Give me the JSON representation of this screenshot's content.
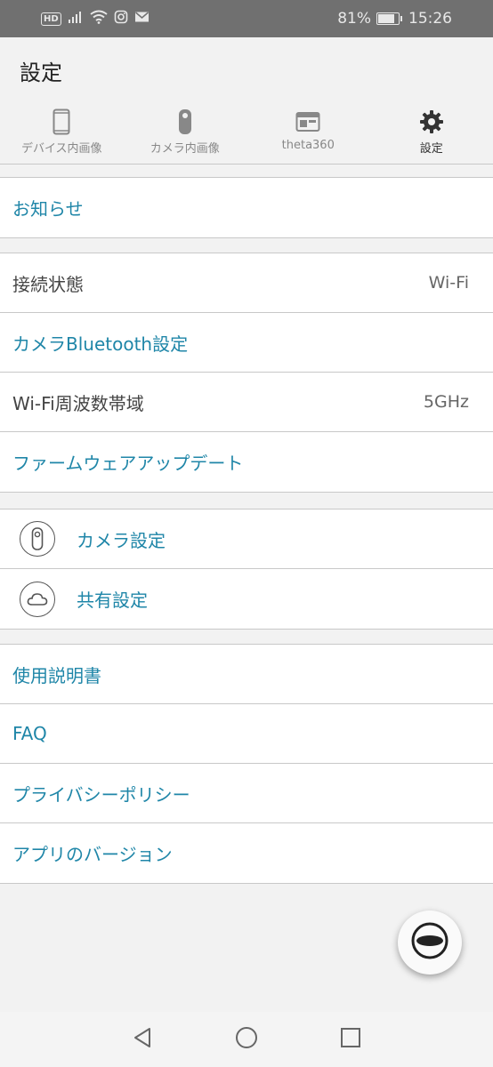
{
  "status_bar": {
    "hd_badge": "HD",
    "battery_percent": "81%",
    "battery_level": 0.81,
    "time": "15:26",
    "icons": [
      "hd-icon",
      "signal-icon",
      "wifi-icon",
      "instagram-icon",
      "mail-icon",
      "battery-icon"
    ]
  },
  "header": {
    "title": "設定"
  },
  "tabs": [
    {
      "label": "デバイス内画像",
      "icon": "phone-icon",
      "active": false
    },
    {
      "label": "カメラ内画像",
      "icon": "camera-icon",
      "active": false
    },
    {
      "label": "theta360",
      "icon": "browser-icon",
      "active": false
    },
    {
      "label": "設定",
      "icon": "gear-icon",
      "active": true
    }
  ],
  "section1": {
    "items": [
      {
        "label": "お知らせ"
      }
    ]
  },
  "section2": {
    "items": [
      {
        "label": "接続状態",
        "value": "Wi-Fi"
      },
      {
        "label": "カメラBluetooth設定"
      },
      {
        "label": "Wi-Fi周波数帯域",
        "value": "5GHz"
      },
      {
        "label": "ファームウェアアップデート"
      }
    ]
  },
  "section3": {
    "items": [
      {
        "label": "カメラ設定",
        "icon": "camera-icon"
      },
      {
        "label": "共有設定",
        "icon": "cloud-icon"
      }
    ]
  },
  "section4": {
    "items": [
      {
        "label": "使用説明書"
      },
      {
        "label": "FAQ"
      },
      {
        "label": "プライバシーポリシー"
      },
      {
        "label": "アプリのバージョン"
      }
    ]
  },
  "fab": {
    "icon": "theta-shoot-icon"
  },
  "nav_bar": {
    "icons": [
      "back-icon",
      "home-icon",
      "recents-icon"
    ]
  },
  "colors": {
    "link_blue": "#1f86a8",
    "status_bar_bg": "#707070",
    "background": "#f2f2f2"
  }
}
